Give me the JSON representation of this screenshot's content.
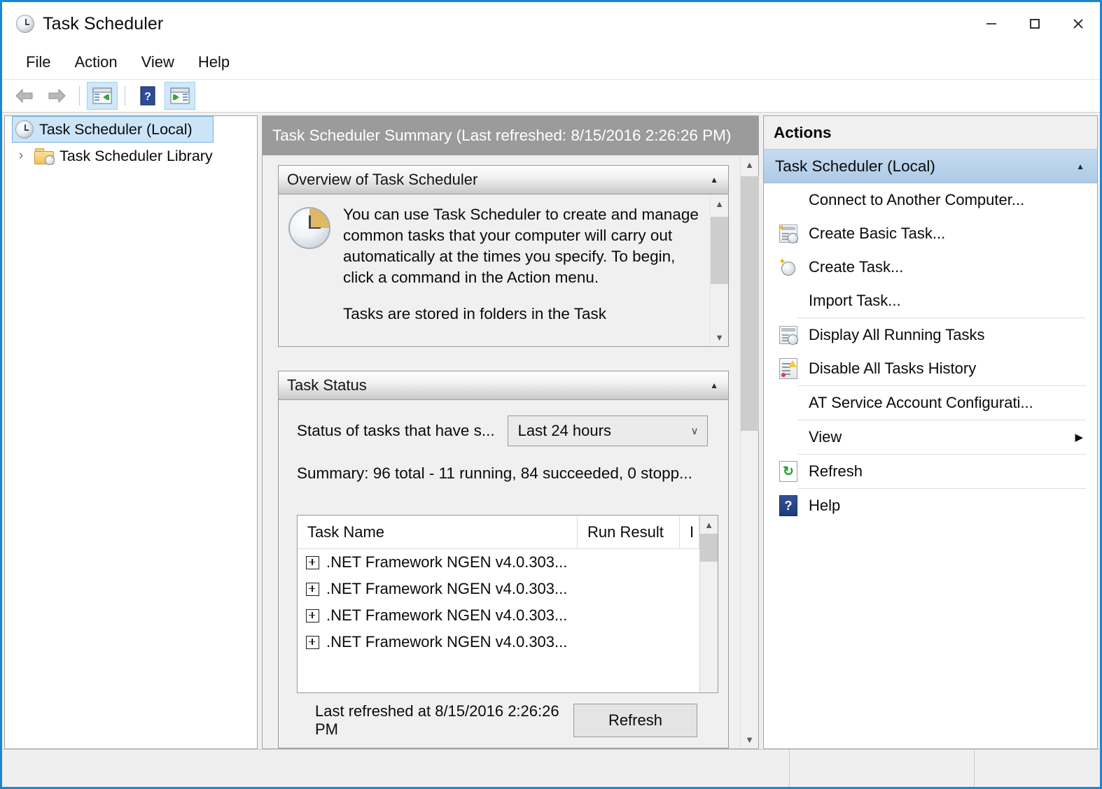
{
  "window": {
    "title": "Task Scheduler",
    "icon": "clock-icon",
    "controls": {
      "minimize": "—",
      "maximize": "□",
      "close": "✕"
    },
    "border_color": "#1b86d4"
  },
  "menubar": {
    "items": [
      "File",
      "Action",
      "View",
      "Help"
    ]
  },
  "toolbar": {
    "buttons": [
      {
        "name": "back-arrow-icon",
        "active": false
      },
      {
        "name": "forward-arrow-icon",
        "active": false
      },
      {
        "name": "show-hide-console-tree-icon",
        "active": true
      },
      {
        "name": "help-icon",
        "active": false
      },
      {
        "name": "show-hide-action-pane-icon",
        "active": true
      }
    ]
  },
  "tree": {
    "items": [
      {
        "label": "Task Scheduler (Local)",
        "icon": "clock-icon",
        "selected": true,
        "expandable": false
      },
      {
        "label": "Task Scheduler Library",
        "icon": "folder-clock-icon",
        "selected": false,
        "expandable": true,
        "chevron": "›"
      }
    ]
  },
  "center": {
    "header": "Task Scheduler Summary (Last refreshed: 8/15/2016 2:26:26 PM)",
    "overview": {
      "title": "Overview of Task Scheduler",
      "collapse_glyph": "▲",
      "icon": "clock-icon",
      "paragraph1": "You can use Task Scheduler to create and manage common tasks that your computer will carry out automatically at the times you specify. To begin, click a command in the Action menu.",
      "paragraph2": "Tasks are stored in folders in the Task"
    },
    "task_status": {
      "title": "Task Status",
      "collapse_glyph": "▲",
      "filter_label": "Status of tasks that have s...",
      "filter_value": "Last 24 hours",
      "filter_chevron": "∨",
      "summary": "Summary: 96 total - 11 running, 84 succeeded, 0 stopp...",
      "table": {
        "columns": [
          "Task Name",
          "Run Result",
          "I"
        ],
        "rows": [
          {
            "expander": "+",
            "name": ".NET Framework NGEN v4.0.303...",
            "run_result": "",
            "extra": ""
          },
          {
            "expander": "+",
            "name": ".NET Framework NGEN v4.0.303...",
            "run_result": "",
            "extra": ""
          },
          {
            "expander": "+",
            "name": ".NET Framework NGEN v4.0.303...",
            "run_result": "",
            "extra": ""
          },
          {
            "expander": "+",
            "name": ".NET Framework NGEN v4.0.303...",
            "run_result": "",
            "extra": ""
          }
        ]
      }
    },
    "footer": {
      "last_refreshed": "Last refreshed at 8/15/2016 2:26:26 PM",
      "refresh_button": "Refresh"
    }
  },
  "actions": {
    "title": "Actions",
    "group": {
      "label": "Task Scheduler (Local)",
      "collapse_glyph": "▲"
    },
    "items": [
      {
        "label": "Connect to Another Computer...",
        "icon": "none",
        "separator_after": false
      },
      {
        "label": "Create Basic Task...",
        "icon": "create-basic-task-icon",
        "separator_after": false
      },
      {
        "label": "Create Task...",
        "icon": "create-task-icon",
        "separator_after": false
      },
      {
        "label": "Import Task...",
        "icon": "none",
        "separator_after": true
      },
      {
        "label": "Display All Running Tasks",
        "icon": "display-running-tasks-icon",
        "separator_after": false
      },
      {
        "label": "Disable All Tasks History",
        "icon": "disable-tasks-history-icon",
        "separator_after": true
      },
      {
        "label": "AT Service Account Configurati...",
        "icon": "none",
        "separator_after": true
      },
      {
        "label": "View",
        "icon": "none",
        "submenu_arrow": "▶",
        "separator_after": true
      },
      {
        "label": "Refresh",
        "icon": "refresh-icon",
        "separator_after": true
      },
      {
        "label": "Help",
        "icon": "help-icon",
        "separator_after": false
      }
    ]
  },
  "statusbar": {
    "text": ""
  }
}
